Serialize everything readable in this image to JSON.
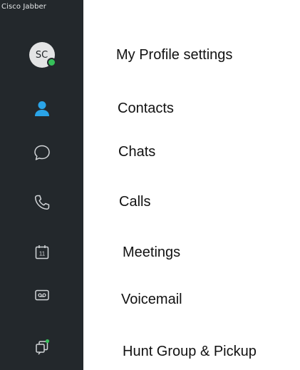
{
  "app": {
    "title": "Cisco Jabber"
  },
  "sidebar": {
    "profile": {
      "initials": "SC",
      "presence_color": "#36c05a"
    },
    "items": [
      {
        "id": "profile",
        "icon": "avatar"
      },
      {
        "id": "contacts",
        "icon": "contacts-icon",
        "active": true,
        "active_color": "#2aa4e8"
      },
      {
        "id": "chats",
        "icon": "chat-bubble-icon"
      },
      {
        "id": "calls",
        "icon": "phone-icon"
      },
      {
        "id": "meetings",
        "icon": "calendar-icon",
        "calendar_day": "11"
      },
      {
        "id": "voicemail",
        "icon": "voicemail-icon"
      },
      {
        "id": "hunt-group",
        "icon": "hunt-group-icon",
        "badge_color": "#36c05a"
      }
    ]
  },
  "labels": {
    "profile": "My Profile settings",
    "contacts": "Contacts",
    "chats": "Chats",
    "calls": "Calls",
    "meetings": "Meetings",
    "voicemail": "Voicemail",
    "hunt_group": "Hunt Group & Pickup"
  },
  "colors": {
    "sidebar_bg": "#23282c",
    "icon_default": "#d2d5d8",
    "accent": "#2aa4e8",
    "presence": "#36c05a"
  }
}
